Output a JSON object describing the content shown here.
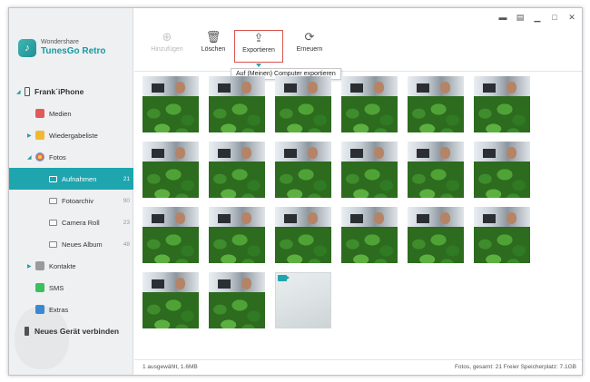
{
  "app": {
    "company": "Wondershare",
    "product": "TunesGo Retro"
  },
  "window_controls": [
    "chat-icon",
    "notes-icon",
    "minimize-icon",
    "close-icon"
  ],
  "sidebar": {
    "device": "Frank´iPhone",
    "items": [
      {
        "label": "Medien",
        "icon": "media-icon"
      },
      {
        "label": "Wiedergabeliste",
        "icon": "playlist-icon"
      },
      {
        "label": "Fotos",
        "icon": "photos-icon"
      },
      {
        "label": "Aufnahmen",
        "count": "21",
        "active": true
      },
      {
        "label": "Fotoarchiv",
        "count": "90"
      },
      {
        "label": "Camera Roll",
        "count": "23"
      },
      {
        "label": "Neues Album",
        "count": "48"
      },
      {
        "label": "Kontakte",
        "icon": "contacts-icon"
      },
      {
        "label": "SMS",
        "icon": "sms-icon"
      },
      {
        "label": "Extras",
        "icon": "extras-icon"
      }
    ],
    "connect": "Neues Gerät verbinden"
  },
  "toolbar": {
    "add": "Hinzufügen",
    "delete": "Löschen",
    "export": "Exportieren",
    "refresh": "Erneuern"
  },
  "tooltip": "Auf (Meinen) Computer exportieren",
  "photos": {
    "count": 21,
    "video_count": 1
  },
  "status": {
    "left": "1 ausgewählt, 1.6MB",
    "right": "Fotos, gesamt: 21    Freier Speicherplatz: 7.1GB"
  },
  "colors": {
    "accent": "#1fa5ae",
    "selected_border": "#d9534f"
  }
}
